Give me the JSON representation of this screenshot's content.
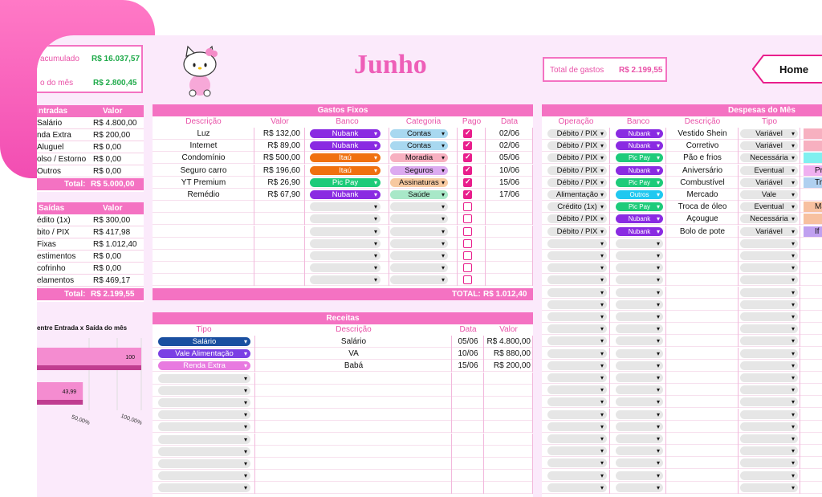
{
  "title": "Junho",
  "total_gastos": {
    "label": "Total de gastos",
    "value": "R$ 2.199,55"
  },
  "home_label": "Home",
  "summary": {
    "acum_label": "acumulado",
    "acum_value": "R$ 16.037,57",
    "mes_label": "o do mês",
    "mes_value": "R$ 2.800,45"
  },
  "entradas": {
    "h1": "ntradas",
    "h2": "Valor",
    "rows": [
      [
        "Salário",
        "R$ 4.800,00"
      ],
      [
        "nda Extra",
        "R$ 200,00"
      ],
      [
        "Aluguel",
        "R$ 0,00"
      ],
      [
        "olso / Estorno",
        "R$ 0,00"
      ],
      [
        "Outros",
        "R$ 0,00"
      ]
    ],
    "total_label": "Total:",
    "total": "R$ 5.000,00"
  },
  "saidas": {
    "h1": "Saídas",
    "h2": "Valor",
    "rows": [
      [
        "édito (1x)",
        "R$ 300,00"
      ],
      [
        "bito / PIX",
        "R$ 417,98"
      ],
      [
        "Fixas",
        "R$ 1.012,40"
      ],
      [
        "estimentos",
        "R$ 0,00"
      ],
      [
        "cofrinho",
        "R$ 0,00"
      ],
      [
        "elamentos",
        "R$ 469,17"
      ]
    ],
    "total_label": "Total:",
    "total": "R$ 2.199,55"
  },
  "mini_chart": {
    "title": "entre Entrada x Saída do mês",
    "ticks": [
      "50,00%",
      "100,00%"
    ],
    "bar1": "100",
    "bar2": "43,99"
  },
  "chart_data": {
    "type": "bar",
    "title": "entre Entrada x Saída do mês",
    "values": [
      100,
      43.99
    ],
    "xlim": [
      0,
      100
    ]
  },
  "fixos": {
    "title": "Gastos Fixos",
    "cols": [
      "Descrição",
      "Valor",
      "Banco",
      "Categoria",
      "Pago",
      "Data"
    ],
    "rows": [
      {
        "d": "Luz",
        "v": "R$ 132,00",
        "b": "Nubank",
        "bc": "#8a2be2",
        "c": "Contas",
        "cc": "#a8d8f0",
        "p": true,
        "dt": "02/06"
      },
      {
        "d": "Internet",
        "v": "R$ 89,00",
        "b": "Nubank",
        "bc": "#8a2be2",
        "c": "Contas",
        "cc": "#a8d8f0",
        "p": true,
        "dt": "02/06"
      },
      {
        "d": "Condomínio",
        "v": "R$ 500,00",
        "b": "Itaú",
        "bc": "#f07010",
        "c": "Moradia",
        "cc": "#f7b0c0",
        "p": true,
        "dt": "05/06"
      },
      {
        "d": "Seguro carro",
        "v": "R$ 196,60",
        "b": "Itaú",
        "bc": "#f07010",
        "c": "Seguros",
        "cc": "#dcaaf0",
        "p": true,
        "dt": "10/06"
      },
      {
        "d": "YT Premium",
        "v": "R$ 26,90",
        "b": "Pic Pay",
        "bc": "#1ecb7a",
        "c": "Assinaturas",
        "cc": "#f7c9a0",
        "p": true,
        "dt": "15/06"
      },
      {
        "d": "Remédio",
        "v": "R$ 67,90",
        "b": "Nubank",
        "bc": "#8a2be2",
        "c": "Saúde",
        "cc": "#a8e8c8",
        "p": true,
        "dt": "17/06"
      }
    ],
    "empty_rows": 7,
    "total_label": "TOTAL:",
    "total": "R$ 1.012,40"
  },
  "receitas": {
    "title": "Receitas",
    "cols": [
      "Tipo",
      "Descrição",
      "Data",
      "Valor"
    ],
    "rows": [
      {
        "t": "Salário",
        "tc": "#1a4fa0",
        "d": "Salário",
        "dt": "05/06",
        "v": "R$ 4.800,00"
      },
      {
        "t": "Vale Alimentação",
        "tc": "#7b3fe4",
        "d": "VA",
        "dt": "10/06",
        "v": "R$ 880,00"
      },
      {
        "t": "Renda Extra",
        "tc": "#e87ae0",
        "d": "Babá",
        "dt": "15/06",
        "v": "R$ 200,00"
      }
    ],
    "empty_rows": 10
  },
  "despesas": {
    "title": "Despesas do Mês",
    "cols": [
      "Operação",
      "Banco",
      "Descrição",
      "Tipo"
    ],
    "rows": [
      {
        "o": "Débito / PIX",
        "b": "Nubank",
        "bc": "#8a2be2",
        "d": "Vestido Shein",
        "t": "Variável",
        "x": "#f7b0c0",
        "xl": ""
      },
      {
        "o": "Débito / PIX",
        "b": "Nubank",
        "bc": "#8a2be2",
        "d": "Corretivo",
        "t": "Variável",
        "x": "#f7b0c0",
        "xl": ""
      },
      {
        "o": "Débito / PIX",
        "b": "Pic Pay",
        "bc": "#1ecb7a",
        "d": "Pão e frios",
        "t": "Necessária",
        "x": "#80f0f0",
        "xl": ""
      },
      {
        "o": "Débito / PIX",
        "b": "Nubank",
        "bc": "#8a2be2",
        "d": "Aniversário",
        "t": "Eventual",
        "x": "#f0b0f0",
        "xl": "Pr"
      },
      {
        "o": "Débito / PIX",
        "b": "Pic Pay",
        "bc": "#1ecb7a",
        "d": "Combustível",
        "t": "Variável",
        "x": "#b0d0f0",
        "xl": "Tran"
      },
      {
        "o": "Alimentação",
        "b": "Outros",
        "bc": "#20c8f0",
        "d": "Mercado",
        "t": "Vale",
        "x": "",
        "xl": ""
      },
      {
        "o": "Crédito (1x)",
        "b": "Pic Pay",
        "bc": "#1ecb7a",
        "d": "Troca de óleo",
        "t": "Eventual",
        "x": "#f7c0a0",
        "xl": "Ma"
      },
      {
        "o": "Débito / PIX",
        "b": "Nubank",
        "bc": "#8a2be2",
        "d": "Açougue",
        "t": "Necessária",
        "x": "#f7c0a0",
        "xl": ""
      },
      {
        "o": "Débito / PIX",
        "b": "Nubank",
        "bc": "#8a2be2",
        "d": "Bolo de pote",
        "t": "Variável",
        "x": "#c0a0f0",
        "xl": "If"
      }
    ],
    "empty_rows": 21
  }
}
